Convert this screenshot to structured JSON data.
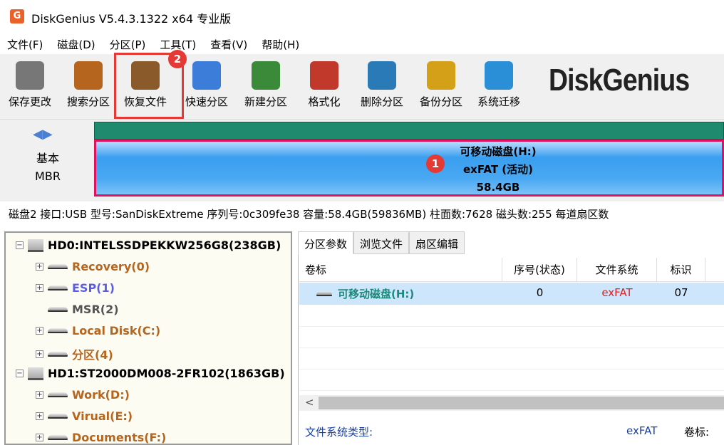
{
  "title": "DiskGenius V5.4.3.1322 x64 专业版",
  "app_icon": "G",
  "menu": [
    "文件(F)",
    "磁盘(D)",
    "分区(P)",
    "工具(T)",
    "查看(V)",
    "帮助(H)"
  ],
  "toolbar": [
    {
      "label": "保存更改",
      "icon": "save-icon",
      "color": "#777777"
    },
    {
      "label": "搜索分区",
      "icon": "search-icon",
      "color": "#b5651d"
    },
    {
      "label": "恢复文件",
      "icon": "recover-file-icon",
      "color": "#8b5a2b"
    },
    {
      "label": "快速分区",
      "icon": "quick-partition-icon",
      "color": "#3b7dd8"
    },
    {
      "label": "新建分区",
      "icon": "new-partition-icon",
      "color": "#3a8a3a"
    },
    {
      "label": "格式化",
      "icon": "format-icon",
      "color": "#c0392b"
    },
    {
      "label": "删除分区",
      "icon": "delete-partition-icon",
      "color": "#2a7ab8"
    },
    {
      "label": "备份分区",
      "icon": "backup-partition-icon",
      "color": "#d4a017"
    },
    {
      "label": "系统迁移",
      "icon": "system-migrate-icon",
      "color": "#2b8fd8"
    }
  ],
  "badges": {
    "one": "1",
    "two": "2"
  },
  "logo": "DiskGenius",
  "diskmap": {
    "type_line1": "基本",
    "type_line2": "MBR",
    "partition_name": "可移动磁盘(H:)",
    "partition_fs": "exFAT (活动)",
    "partition_size": "58.4GB"
  },
  "infoline": "磁盘2 接口:USB  型号:SanDiskExtreme  序列号:0c309fe38  容量:58.4GB(59836MB)  柱面数:7628  磁头数:255  每道扇区数",
  "tree": [
    {
      "label": "HD0:INTELSSDPEKKW256G8(238GB)",
      "kind": "disk",
      "color": "#000000"
    },
    {
      "label": "Recovery(0)",
      "kind": "vol",
      "color": "#b5651d"
    },
    {
      "label": "ESP(1)",
      "kind": "vol",
      "color": "#5b5bea"
    },
    {
      "label": "MSR(2)",
      "kind": "vol",
      "color": "#555555"
    },
    {
      "label": "Local Disk(C:)",
      "kind": "vol",
      "color": "#b5651d"
    },
    {
      "label": "分区(4)",
      "kind": "vol",
      "color": "#b5651d"
    },
    {
      "label": "HD1:ST2000DM008-2FR102(1863GB)",
      "kind": "disk",
      "color": "#000000"
    },
    {
      "label": "Work(D:)",
      "kind": "vol",
      "color": "#b5651d"
    },
    {
      "label": "Virual(E:)",
      "kind": "vol",
      "color": "#b5651d"
    },
    {
      "label": "Documents(F:)",
      "kind": "vol",
      "color": "#b5651d"
    }
  ],
  "tabs": [
    "分区参数",
    "浏览文件",
    "扇区编辑"
  ],
  "table": {
    "headers": [
      "卷标",
      "序号(状态)",
      "文件系统",
      "标识"
    ],
    "row": {
      "name": "可移动磁盘(H:)",
      "index": "0",
      "fs": "exFAT",
      "id": "07"
    }
  },
  "bottom": {
    "fs_type_label": "文件系统类型:",
    "fs_type_value": "exFAT",
    "volume_label": "卷标:"
  }
}
